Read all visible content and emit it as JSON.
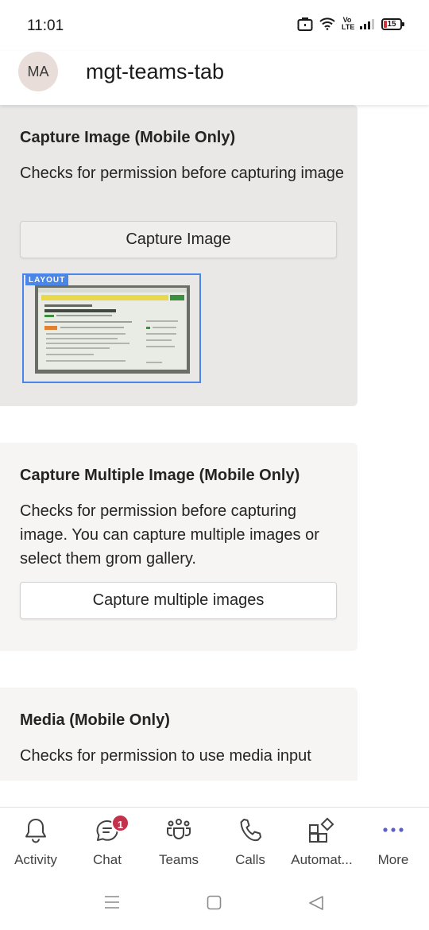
{
  "status_bar": {
    "time": "11:01",
    "volte_label": "Vo LTE",
    "battery_level": "15"
  },
  "header": {
    "avatar_initials": "MA",
    "title": "mgt-teams-tab"
  },
  "cards": [
    {
      "title": "Capture Image (Mobile Only)",
      "description": "Checks for permission before capturing image",
      "button_label": "Capture Image",
      "preview_tag": "LAYOUT"
    },
    {
      "title": "Capture Multiple Image (Mobile Only)",
      "description": "Checks for permission before capturing image. You can capture multiple images or select them grom gallery.",
      "button_label": "Capture multiple images"
    },
    {
      "title": "Media (Mobile Only)",
      "description": "Checks for permission to use media input"
    }
  ],
  "bottom_nav": [
    {
      "label": "Activity",
      "icon": "bell-icon"
    },
    {
      "label": "Chat",
      "icon": "chat-icon",
      "badge": "1"
    },
    {
      "label": "Teams",
      "icon": "teams-icon"
    },
    {
      "label": "Calls",
      "icon": "phone-icon"
    },
    {
      "label": "Automat...",
      "icon": "apps-icon"
    },
    {
      "label": "More",
      "icon": "more-icon"
    }
  ],
  "colors": {
    "accent_badge": "#c4314b",
    "layout_tag": "#4a86e8",
    "card_active_bg": "#eae8e6",
    "card_bg": "#f7f5f3"
  }
}
